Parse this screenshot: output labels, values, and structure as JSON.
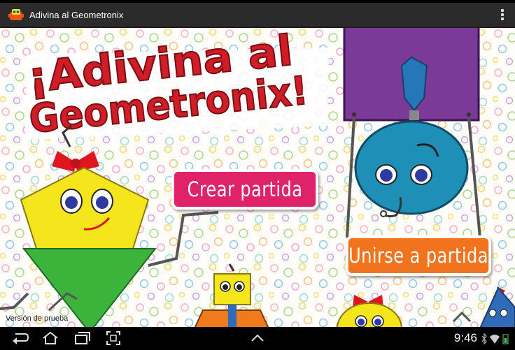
{
  "app": {
    "title": "Adivina al Geometronix"
  },
  "game": {
    "logo_line1": "¡Adivina al",
    "logo_line2": "Geometronix!",
    "create_button": "Crear partida",
    "join_button": "Unirse a partida",
    "version_label": "Versión de prueba"
  },
  "status": {
    "clock": "9:46"
  },
  "colors": {
    "create_button": "#e0226b",
    "join_button": "#f2731d",
    "logo_red": "#d11d27",
    "pentagon_yellow": "#f5e51c",
    "triangle_green": "#3cb43c",
    "square_purple": "#7b3a97",
    "circle_blue": "#1e90b8"
  },
  "icons": {
    "app": "robot-app-icon",
    "menu": "overflow-menu-icon",
    "back": "back-icon",
    "home": "home-icon",
    "recents": "recent-apps-icon",
    "screenshot": "screenshot-icon",
    "up": "chevron-up-icon",
    "bluetooth": "bluetooth-icon",
    "wifi": "wifi-icon",
    "battery": "battery-icon"
  }
}
